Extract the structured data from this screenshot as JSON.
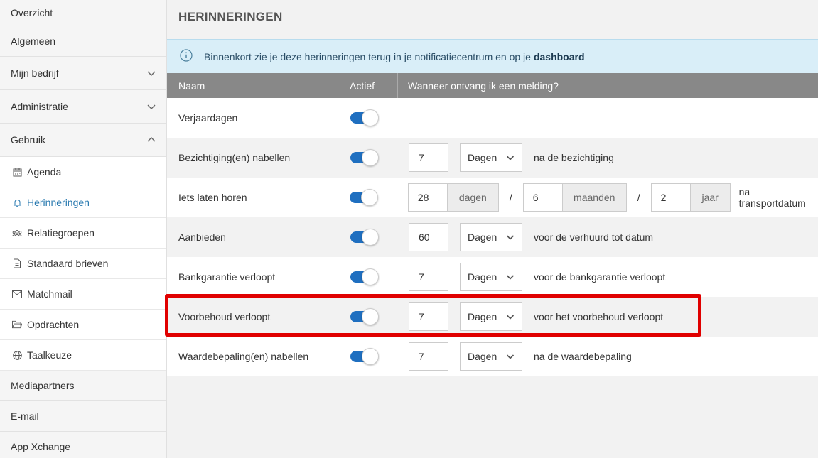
{
  "sidebar": {
    "items_top": [
      {
        "label": "Overzicht"
      },
      {
        "label": "Algemeen"
      },
      {
        "label": "Mijn bedrijf"
      },
      {
        "label": "Administratie"
      },
      {
        "label": "Gebruik"
      }
    ],
    "sub_items": [
      {
        "label": "Agenda",
        "icon": "calendar-icon"
      },
      {
        "label": "Herinneringen",
        "icon": "bell-icon",
        "active": true
      },
      {
        "label": "Relatiegroepen",
        "icon": "group-icon"
      },
      {
        "label": "Standaard brieven",
        "icon": "document-icon"
      },
      {
        "label": "Matchmail",
        "icon": "envelope-icon"
      },
      {
        "label": "Opdrachten",
        "icon": "folder-icon"
      },
      {
        "label": "Taalkeuze",
        "icon": "globe-icon"
      }
    ],
    "items_bottom": [
      {
        "label": "Mediapartners"
      },
      {
        "label": "E-mail"
      },
      {
        "label": "App Xchange"
      }
    ]
  },
  "page": {
    "title": "HERINNERINGEN",
    "info_text": "Binnenkort zie je deze herinneringen terug in je notificatiecentrum en op je",
    "info_bold": "dashboard"
  },
  "table": {
    "headers": [
      "Naam",
      "Actief",
      "Wanneer ontvang ik een melding?"
    ],
    "rows": [
      {
        "name": "Verjaardagen",
        "active": true
      },
      {
        "name": "Bezichtiging(en) nabellen",
        "active": true,
        "value": "7",
        "unit": "Dagen",
        "suffix": "na de bezichtiging"
      },
      {
        "name": "Iets laten horen",
        "active": true,
        "days": "28",
        "days_label": "dagen",
        "months": "6",
        "months_label": "maanden",
        "years": "2",
        "years_label": "jaar",
        "separator": "/",
        "suffix": "na transportdatum"
      },
      {
        "name": "Aanbieden",
        "active": true,
        "value": "60",
        "unit": "Dagen",
        "suffix": "voor de verhuurd tot datum"
      },
      {
        "name": "Bankgarantie verloopt",
        "active": true,
        "value": "7",
        "unit": "Dagen",
        "suffix": "voor de bankgarantie verloopt"
      },
      {
        "name": "Voorbehoud verloopt",
        "active": true,
        "value": "7",
        "unit": "Dagen",
        "suffix": "voor het voorbehoud verloopt",
        "highlighted": true
      },
      {
        "name": "Waardebepaling(en) nabellen",
        "active": true,
        "value": "7",
        "unit": "Dagen",
        "suffix": "na de waardebepaling"
      }
    ]
  },
  "colors": {
    "accent": "#1f6fc0",
    "active_link": "#2a7ab0",
    "header_bg": "#888888",
    "info_bg": "#d9eef8",
    "highlight": "#e00000"
  }
}
